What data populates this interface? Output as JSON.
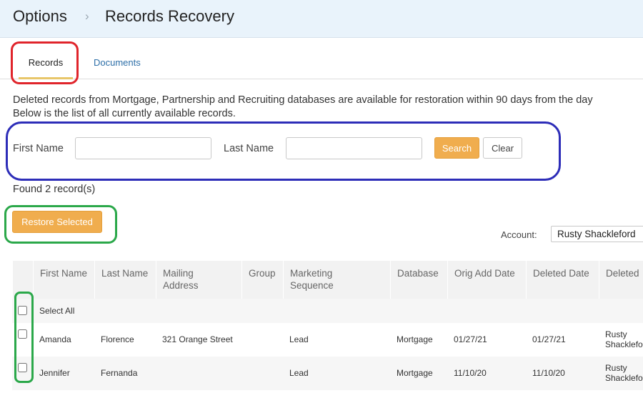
{
  "header": {
    "breadcrumb_root": "Options",
    "separator": "›",
    "title": "Records Recovery"
  },
  "tabs": [
    {
      "label": "Records",
      "active": true
    },
    {
      "label": "Documents",
      "active": false
    }
  ],
  "description": {
    "line1": "Deleted records from Mortgage, Partnership and Recruiting databases are available for restoration within 90 days from the day",
    "line2": "Below is the list of all currently available records."
  },
  "search": {
    "first_name_label": "First Name",
    "first_name_value": "",
    "last_name_label": "Last Name",
    "last_name_value": "",
    "search_label": "Search",
    "clear_label": "Clear"
  },
  "found_text": "Found 2 record(s)",
  "restore_label": "Restore Selected",
  "account": {
    "label": "Account:",
    "selected": "Rusty Shackleford"
  },
  "table": {
    "columns": [
      "First Name",
      "Last Name",
      "Mailing Address",
      "Group",
      "Marketing Sequence",
      "Database",
      "Orig Add Date",
      "Deleted Date",
      "Deleted"
    ],
    "select_all_label": "Select All",
    "rows": [
      {
        "first": "Amanda",
        "last": "Florence",
        "address": "321 Orange Street",
        "group": "",
        "sequence": "Lead",
        "database": "Mortgage",
        "orig_add": "01/27/21",
        "deleted_date": "01/27/21",
        "deleted_by_1": "Rusty",
        "deleted_by_2": "Shacklefo"
      },
      {
        "first": "Jennifer",
        "last": "Fernanda",
        "address": "",
        "group": "",
        "sequence": "Lead",
        "database": "Mortgage",
        "orig_add": "11/10/20",
        "deleted_date": "11/10/20",
        "deleted_by_1": "Rusty",
        "deleted_by_2": "Shacklefo"
      }
    ]
  },
  "colors": {
    "accent_orange": "#f0ad4e",
    "annotation_red": "#e0242b",
    "annotation_blue": "#2d2db8",
    "annotation_green": "#2ba84a"
  }
}
